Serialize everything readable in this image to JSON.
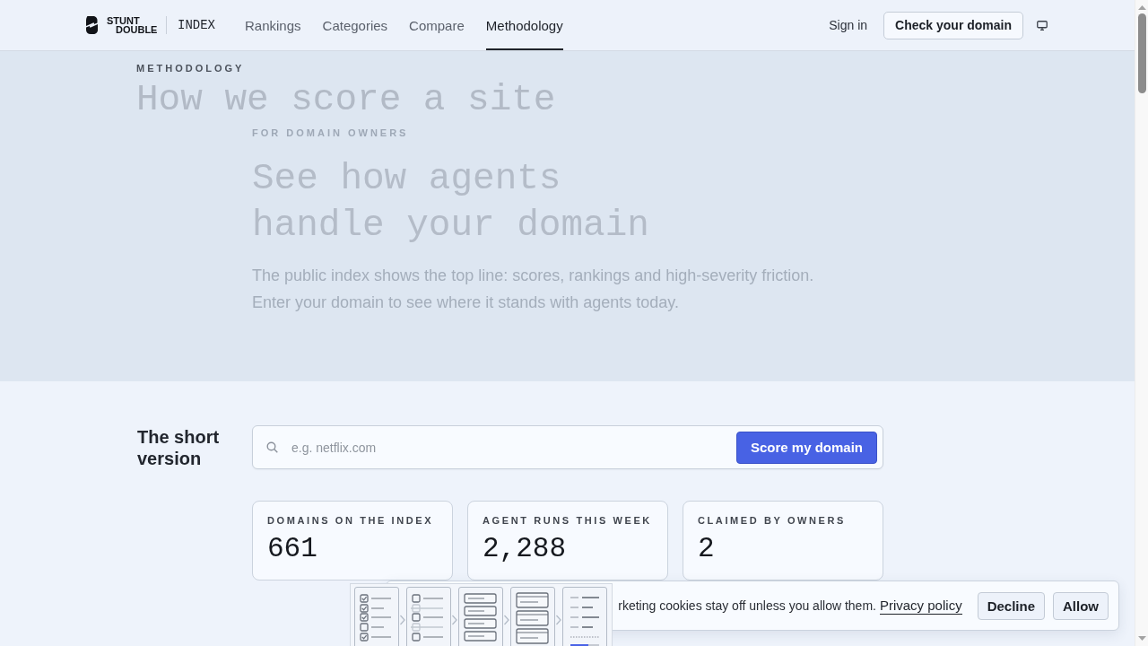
{
  "header": {
    "logo": {
      "name": "STUNT DOUBLE",
      "product": "INDEX"
    },
    "nav": [
      {
        "label": "Rankings",
        "selected": false
      },
      {
        "label": "Categories",
        "selected": false
      },
      {
        "label": "Compare",
        "selected": false
      },
      {
        "label": "Methodology",
        "selected": true
      }
    ],
    "sign_in": "Sign in",
    "cta": "Check your domain"
  },
  "hero_methodology": {
    "eyebrow": "METHODOLOGY",
    "heading": "How we score a site"
  },
  "hero_owners": {
    "eyebrow": "FOR DOMAIN OWNERS",
    "heading": "See how agents handle your domain",
    "text": "The public index shows the top line: scores, rankings and high-severity friction. Enter your domain to see where it stands with agents today."
  },
  "short_version": {
    "heading": "The short version"
  },
  "domain_search": {
    "placeholder": "e.g. netflix.com",
    "button": "Score my domain"
  },
  "stats": [
    {
      "label": "DOMAINS ON THE INDEX",
      "value": "661"
    },
    {
      "label": "AGENT RUNS THIS WEEK",
      "value": "2,288"
    },
    {
      "label": "CLAIMED BY OWNERS",
      "value": "2"
    }
  ],
  "illustration": {
    "steps": [
      {
        "kind": "checklist"
      },
      {
        "kind": "form"
      },
      {
        "kind": "list"
      },
      {
        "kind": "cards"
      },
      {
        "kind": "summary"
      }
    ]
  },
  "cookie_banner": {
    "message": "rketing cookies stay off unless you allow them.",
    "link": "Privacy policy",
    "buttons": [
      "Decline",
      "Allow"
    ]
  }
}
